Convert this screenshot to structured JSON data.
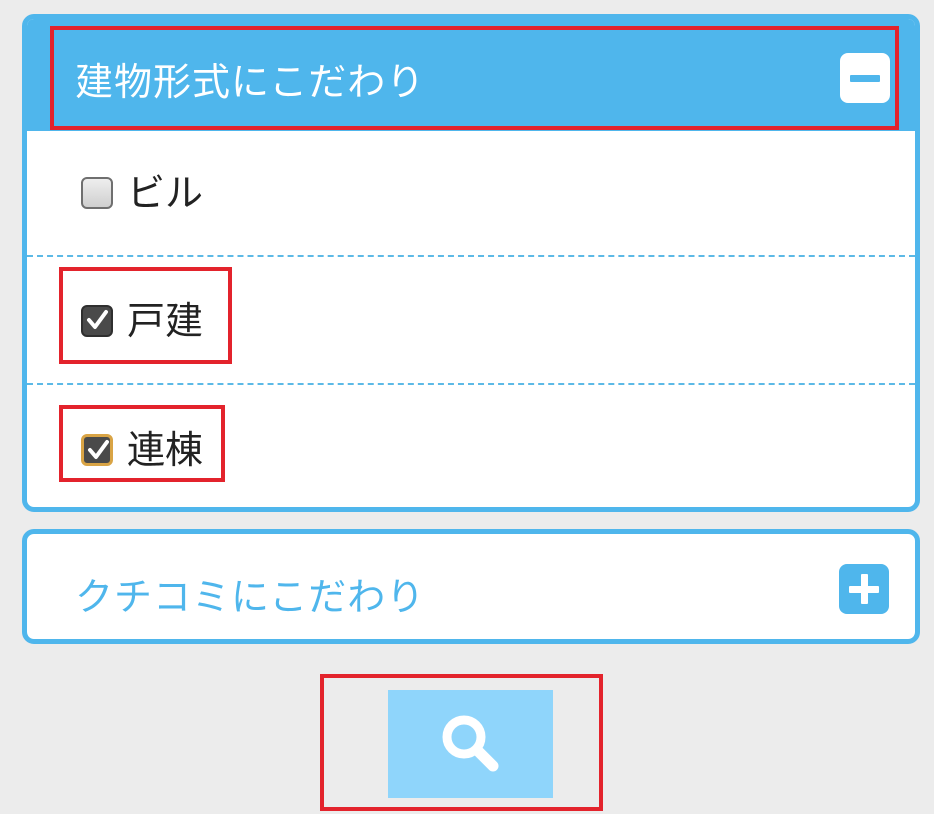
{
  "building_type_panel": {
    "title": "建物形式にこだわり",
    "toggle_icon": "minus-icon",
    "options": [
      {
        "label": "ビル",
        "checked": false
      },
      {
        "label": "戸建",
        "checked": true
      },
      {
        "label": "連棟",
        "checked": true
      }
    ]
  },
  "reviews_panel": {
    "title": "クチコミにこだわり",
    "toggle_icon": "plus-icon"
  },
  "search_button": {
    "icon": "search-icon"
  },
  "colors": {
    "accent": "#4fb6ec",
    "search_button": "#8fd5fb",
    "highlight": "#e3232c",
    "background": "#ececec"
  }
}
